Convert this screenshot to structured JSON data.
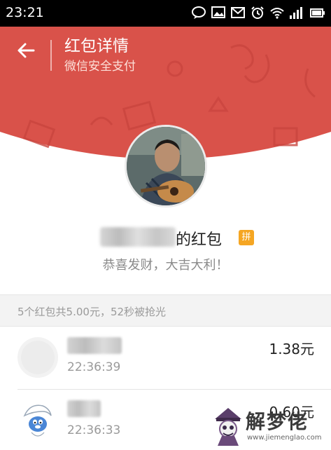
{
  "status_bar": {
    "time": "23:21",
    "icons": [
      "message-icon",
      "image-icon",
      "mail-icon",
      "alarm-icon",
      "wifi-icon",
      "signal-icon",
      "battery-icon"
    ]
  },
  "header": {
    "title": "红包详情",
    "subtitle": "微信安全支付",
    "back_icon": "back-arrow-icon",
    "color": "#d9524a"
  },
  "sender": {
    "name_suffix": "的红包",
    "badge": "拼",
    "wish": "恭喜发财，大吉大利！"
  },
  "summary": "5个红包共5.00元，52秒被抢光",
  "records": [
    {
      "time": "22:36:39",
      "amount": "1.38元"
    },
    {
      "time": "22:36:33",
      "amount": "0.60元"
    }
  ],
  "watermark": {
    "text": "解梦佬",
    "url": "www.jiemenglao.com"
  }
}
